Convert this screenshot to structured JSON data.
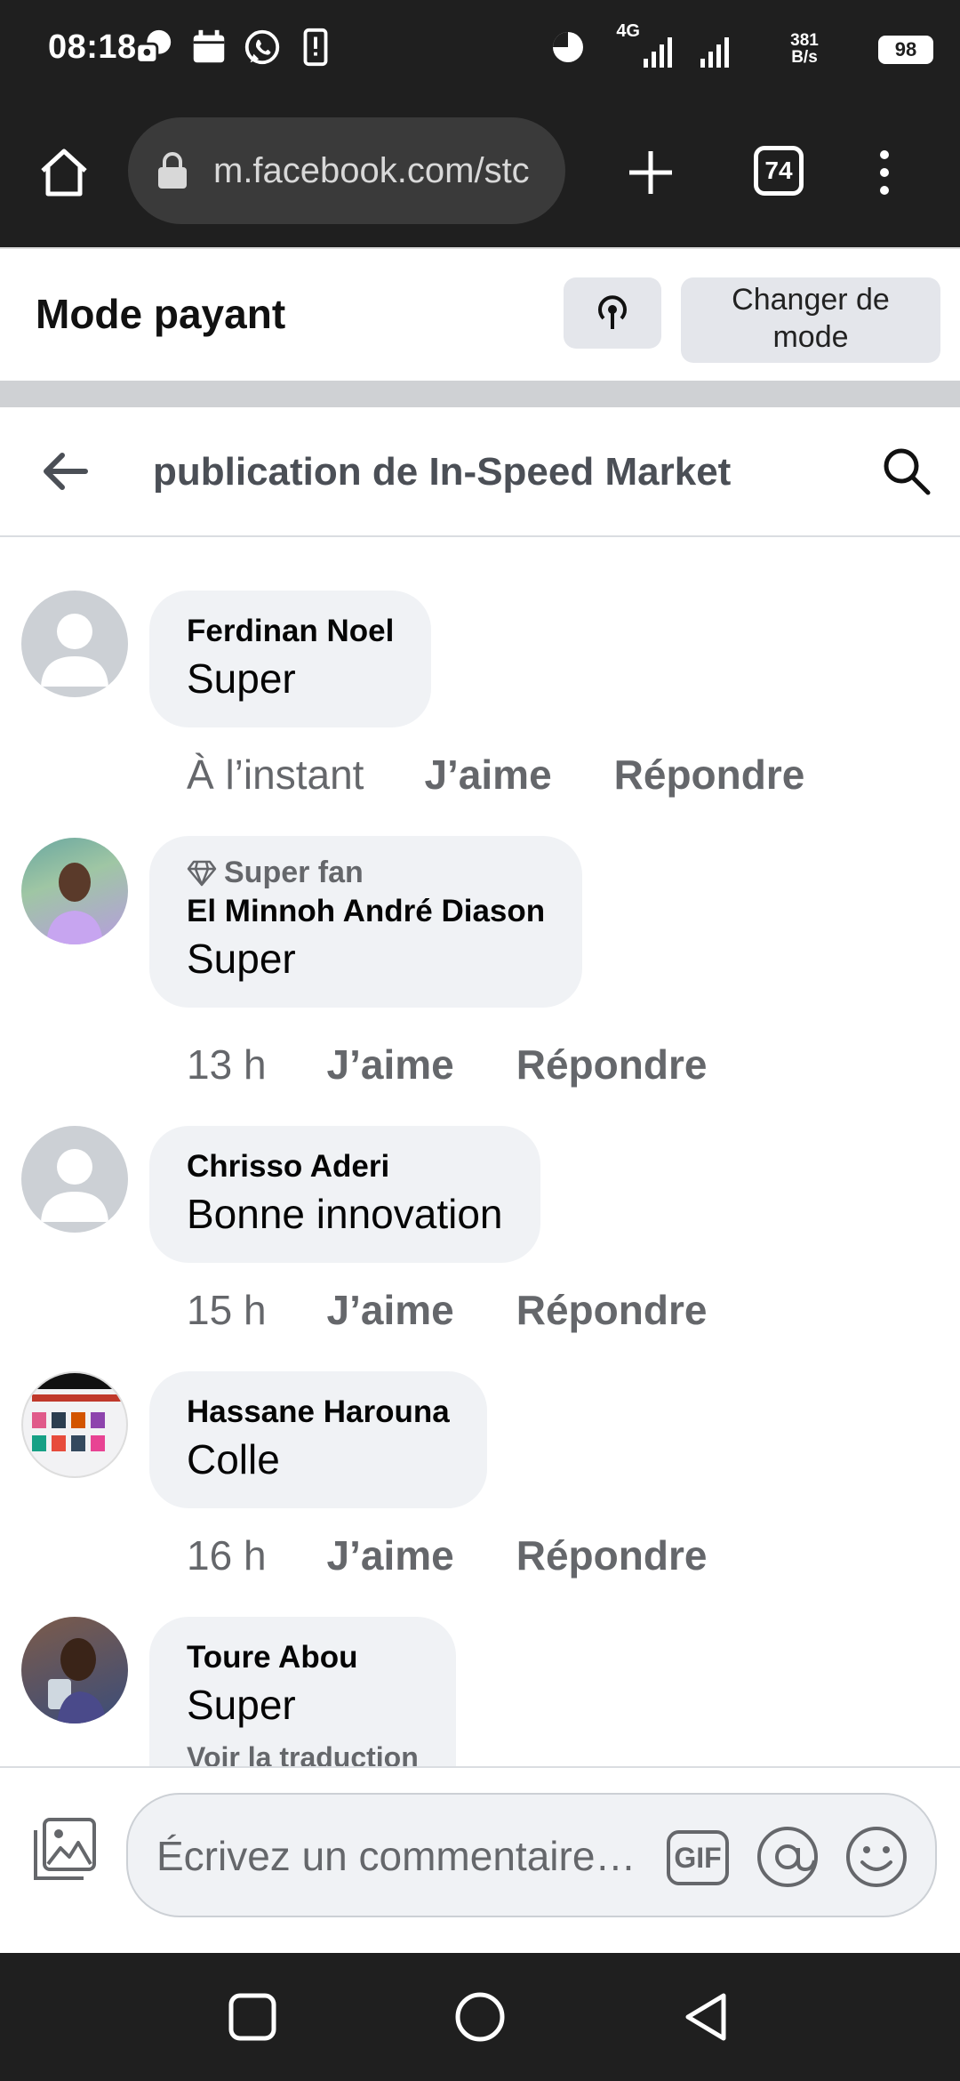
{
  "status_bar": {
    "time": "08:18",
    "network": "4G",
    "speed": "381 B/s",
    "battery": "98",
    "icons": [
      "messenger-icon",
      "calendar-icon",
      "whatsapp-icon",
      "phone-icon",
      "data-saver-icon",
      "signal-icon",
      "signal-icon-2",
      "battery-icon"
    ]
  },
  "browser": {
    "url": "m.facebook.com/stc",
    "tab_count": "74"
  },
  "mode_bar": {
    "title": "Mode payant",
    "change_label_line1": "Changer de",
    "change_label_line2": "mode"
  },
  "header": {
    "title": "publication de In-Speed Market"
  },
  "comments": [
    {
      "name": "Ferdinan Noel",
      "text": "Super",
      "time": "À l’instant",
      "like": "J’aime",
      "reply": "Répondre"
    },
    {
      "badge": "Super fan",
      "name": "El Minnoh André Diason",
      "text": "Super",
      "time": "13 h",
      "like": "J’aime",
      "reply": "Répondre"
    },
    {
      "name": "Chrisso Aderi",
      "text": "Bonne innovation",
      "time": "15 h",
      "like": "J’aime",
      "reply": "Répondre"
    },
    {
      "name": "Hassane Harouna",
      "text": "Colle",
      "time": "16 h",
      "like": "J’aime",
      "reply": "Répondre"
    },
    {
      "name": "Toure Abou",
      "text": "Super",
      "see_translation": "Voir la traduction"
    }
  ],
  "composer": {
    "placeholder": "Écrivez un commentaire…",
    "gif_label": "GIF"
  },
  "colors": {
    "bubble": "#f0f2f5",
    "meta_text": "#65676b",
    "system_bar": "#1f1f1f"
  }
}
